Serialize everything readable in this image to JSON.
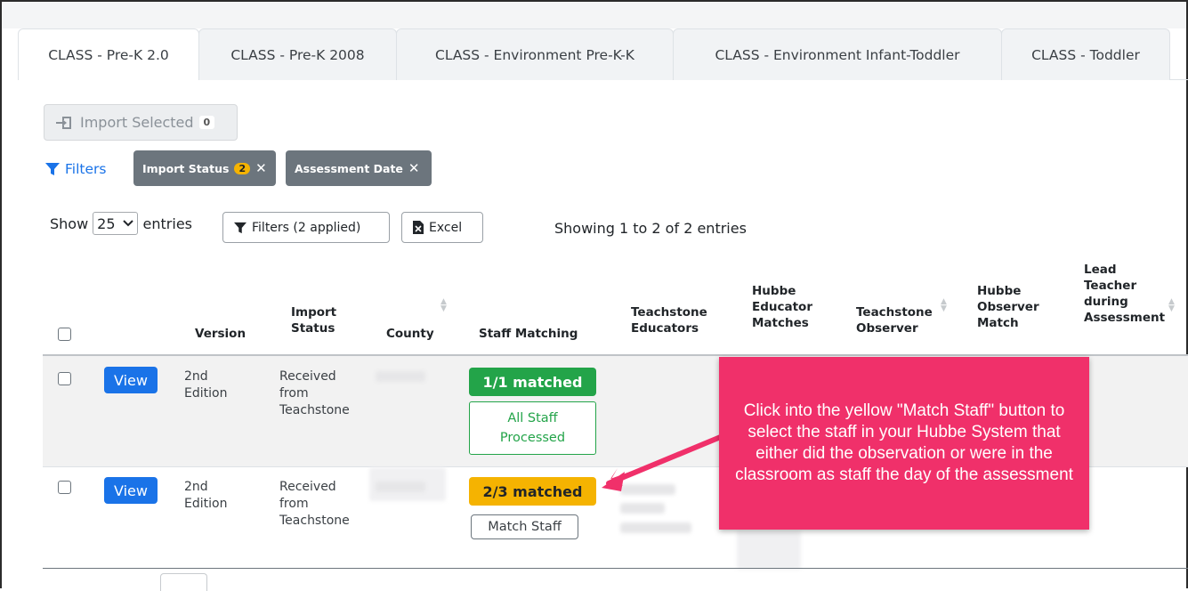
{
  "tabs": [
    {
      "label": "CLASS - Pre-K 2.0",
      "active": true
    },
    {
      "label": "CLASS - Pre-K 2008",
      "active": false
    },
    {
      "label": "CLASS - Environment Pre-K-K",
      "active": false
    },
    {
      "label": "CLASS - Environment Infant-Toddler",
      "active": false
    },
    {
      "label": "CLASS - Toddler",
      "active": false
    }
  ],
  "toolbar": {
    "import_selected_label": "Import Selected",
    "import_selected_count": "0",
    "filters_label": "Filters",
    "chips": [
      {
        "label": "Import Status",
        "badge": "2"
      },
      {
        "label": "Assessment Date",
        "badge": ""
      }
    ]
  },
  "controls": {
    "show_label": "Show",
    "entries_value": "25",
    "entries_label": "entries",
    "filters_button": "Filters (2 applied)",
    "excel_button": "Excel",
    "showing_text": "Showing 1 to 2 of 2 entries"
  },
  "table": {
    "headers": {
      "version": "Version",
      "import_status_1": "Import",
      "import_status_2": "Status",
      "county": "County",
      "staff_matching": "Staff Matching",
      "teachstone_educators_1": "Teachstone",
      "teachstone_educators_2": "Educators",
      "hubbe_educator_1": "Hubbe",
      "hubbe_educator_2": "Educator",
      "hubbe_educator_3": "Matches",
      "teachstone_observer_1": "Teachstone",
      "teachstone_observer_2": "Observer",
      "hubbe_observer_1": "Hubbe",
      "hubbe_observer_2": "Observer",
      "hubbe_observer_3": "Match",
      "lead_teacher_1": "Lead",
      "lead_teacher_2": "Teacher",
      "lead_teacher_3": "during",
      "lead_teacher_4": "Assessment"
    },
    "rows": [
      {
        "view": "View",
        "version_1": "2nd",
        "version_2": "Edition",
        "status_1": "Received",
        "status_2": "from",
        "status_3": "Teachstone",
        "match_badge": "1/1 matched",
        "match_action_1": "All Staff",
        "match_action_2": "Processed"
      },
      {
        "view": "View",
        "version_1": "2nd",
        "version_2": "Edition",
        "status_1": "Received",
        "status_2": "from",
        "status_3": "Teachstone",
        "match_badge": "2/3 matched",
        "match_action": "Match Staff"
      }
    ]
  },
  "callout": {
    "text": "Click into the yellow \"Match Staff\" button to select the staff in your Hubbe System that either did the observation or were in the classroom as staff the day of the assessment",
    "color": "#f0306a"
  },
  "colors": {
    "primary": "#1a73e8",
    "success": "#23a449",
    "warning": "#f5b301",
    "chip": "#6c757d"
  }
}
